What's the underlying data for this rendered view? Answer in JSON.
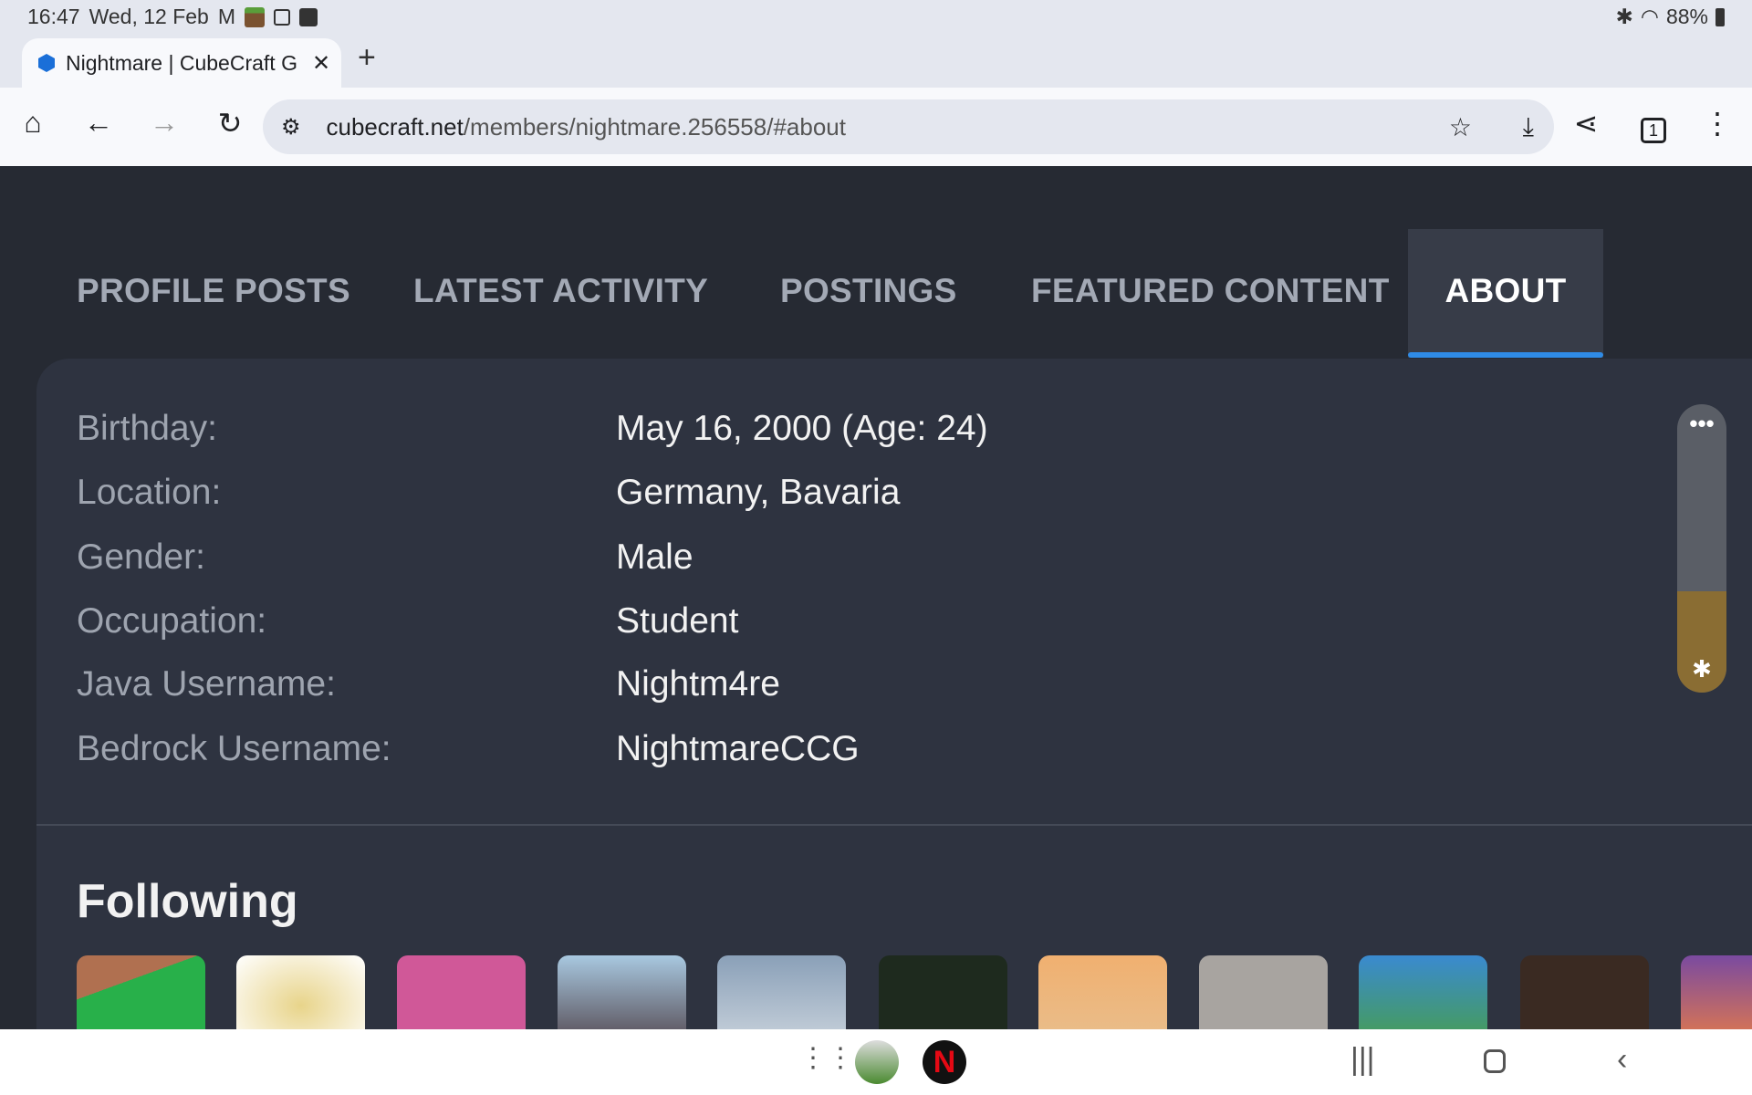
{
  "status_bar": {
    "time": "16:47",
    "date": "Wed, 12 Feb",
    "battery": "88%"
  },
  "browser": {
    "tab_title": "Nightmare | CubeCraft G",
    "url_host": "cubecraft.net",
    "url_path": "/members/nightmare.256558/#about",
    "tab_count": "1"
  },
  "profile": {
    "tabs": [
      {
        "label": "PROFILE POSTS"
      },
      {
        "label": "LATEST ACTIVITY"
      },
      {
        "label": "POSTINGS"
      },
      {
        "label": "FEATURED CONTENT"
      },
      {
        "label": "ABOUT",
        "active": true
      }
    ],
    "about": [
      {
        "label": "Birthday:",
        "value": "May 16, 2000 (Age: 24)"
      },
      {
        "label": "Location:",
        "value": "Germany, Bavaria"
      },
      {
        "label": "Gender:",
        "value": "Male"
      },
      {
        "label": "Occupation:",
        "value": "Student"
      },
      {
        "label": "Java Username:",
        "value": "Nightm4re"
      },
      {
        "label": "Bedrock Username:",
        "value": "NightmareCCG"
      }
    ],
    "following_heading": "Following"
  },
  "colors": {
    "accent": "#2f8be6",
    "panel": "#2e3340",
    "background": "#262a33"
  }
}
